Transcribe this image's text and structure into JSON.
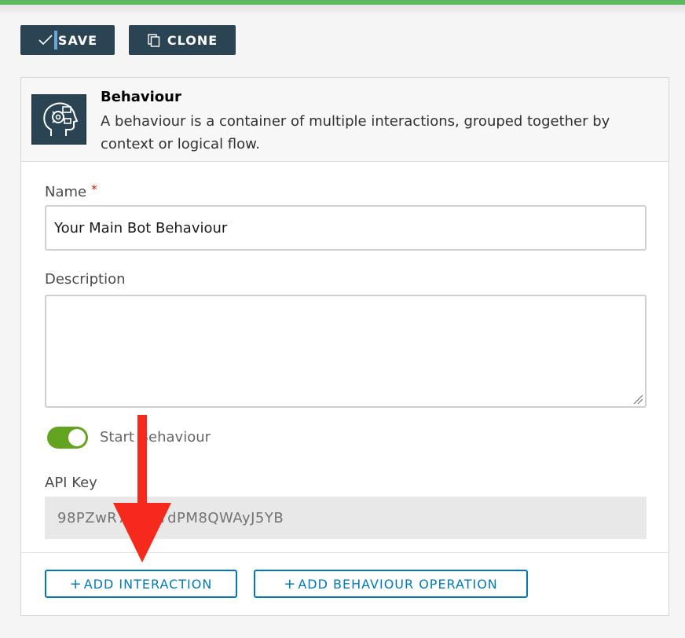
{
  "toolbar": {
    "save_label": "SAVE",
    "clone_label": "CLONE"
  },
  "card": {
    "header": {
      "icon": "behaviour-head-gears-icon",
      "title": "Behaviour",
      "description": "A behaviour is a container of multiple interactions, grouped together by context or logical flow."
    },
    "name_field": {
      "label": "Name",
      "required_mark": "*",
      "value": "Your Main Bot Behaviour"
    },
    "description_field": {
      "label": "Description",
      "value": ""
    },
    "start_toggle": {
      "label": "Start Behaviour",
      "checked": true
    },
    "api_key_field": {
      "label": "API Key",
      "value": "98PZwR78GNYdPM8QWAyJ5YB"
    },
    "actions": {
      "add_interaction_label": "ADD INTERACTION",
      "add_operation_label": "ADD BEHAVIOUR OPERATION",
      "plus_glyph": "+"
    }
  },
  "colors": {
    "top_bar": "#5cb85c",
    "primary_dark": "#2b4453",
    "link_blue": "#0079b8",
    "toggle_green": "#62a420",
    "annotation_arrow": "#f5291c"
  }
}
